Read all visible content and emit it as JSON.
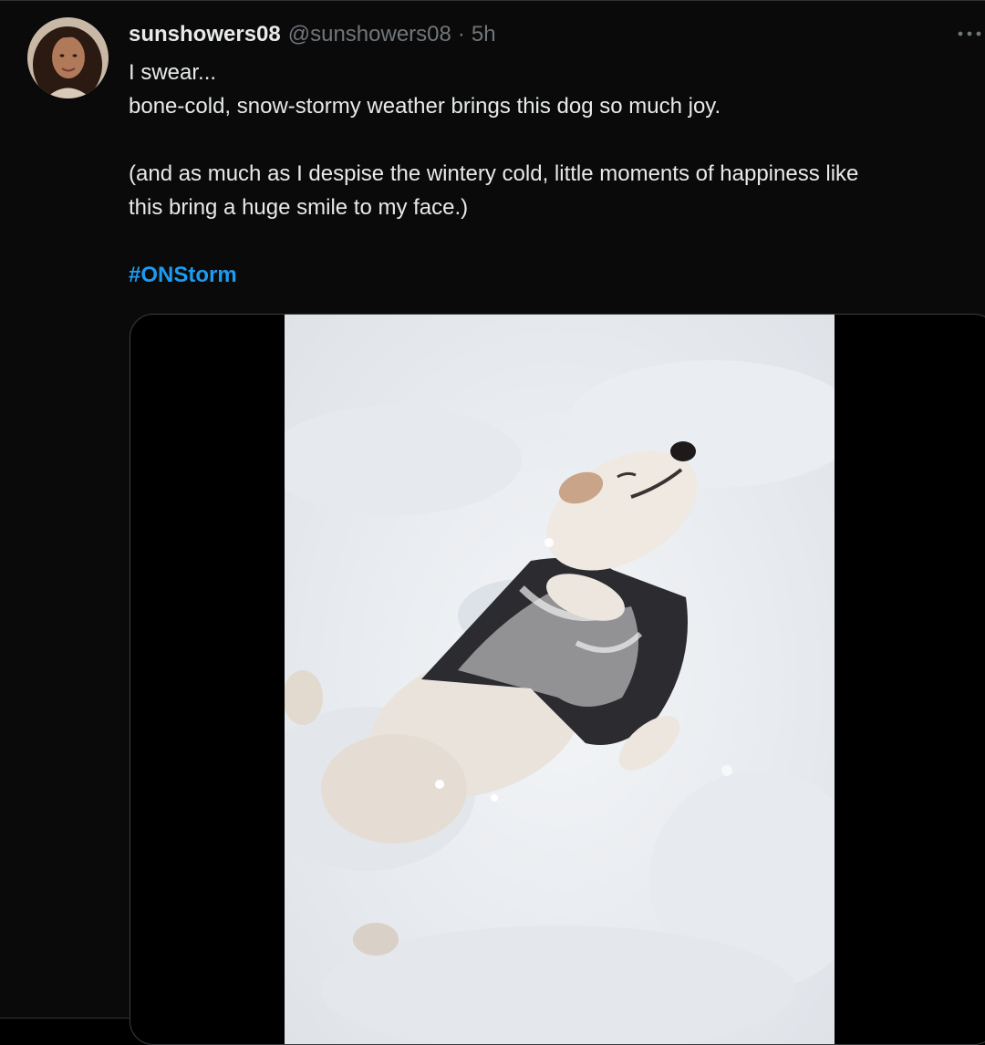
{
  "tweet": {
    "author": {
      "display_name": "sunshowers08",
      "handle": "@sunshowers08"
    },
    "separator": "·",
    "timestamp": "5h",
    "text_lines": [
      "I swear...",
      "bone-cold, snow-stormy weather brings this dog so much joy.",
      "",
      "(and as much as I despise the wintery cold, little moments of happiness like",
      "this bring a huge smile to my face.)",
      ""
    ],
    "hashtag": "#ONStorm"
  },
  "icons": {
    "more": "more-options-icon",
    "avatar": "user-avatar"
  },
  "colors": {
    "background": "#000000",
    "text_primary": "#e7e9ea",
    "text_secondary": "#71767b",
    "link": "#1d9bf0",
    "border": "#2f3336"
  }
}
